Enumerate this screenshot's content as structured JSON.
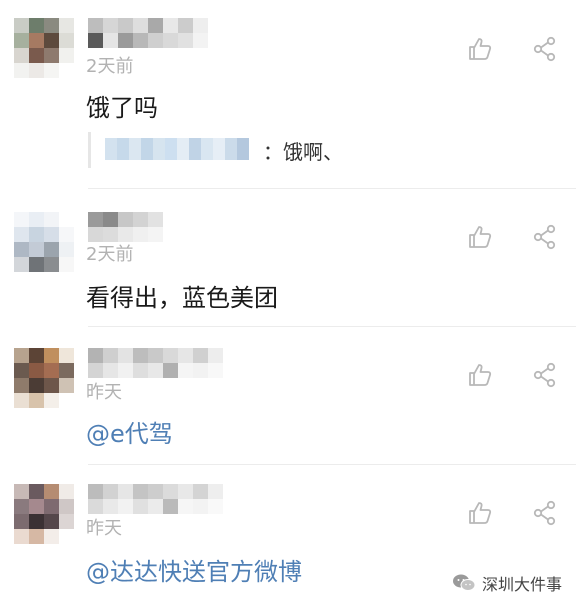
{
  "comments": [
    {
      "time": "2天前",
      "text": "饿了吗",
      "reply_text": "：饿啊、"
    },
    {
      "time": "2天前",
      "text": "看得出，蓝色美团"
    },
    {
      "time": "昨天",
      "text": "@e代驾"
    },
    {
      "time": "昨天",
      "text": "@达达快送官方微博"
    }
  ],
  "watermark": {
    "label": "深圳大件事",
    "icon": "wechat-icon"
  },
  "icons": {
    "like": "thumbs-up-icon",
    "share": "share-icon"
  },
  "colors": {
    "mention": "#4f7fb5",
    "time": "#b2b2b2",
    "icon": "#b8b8b8",
    "divider": "#ececec"
  }
}
